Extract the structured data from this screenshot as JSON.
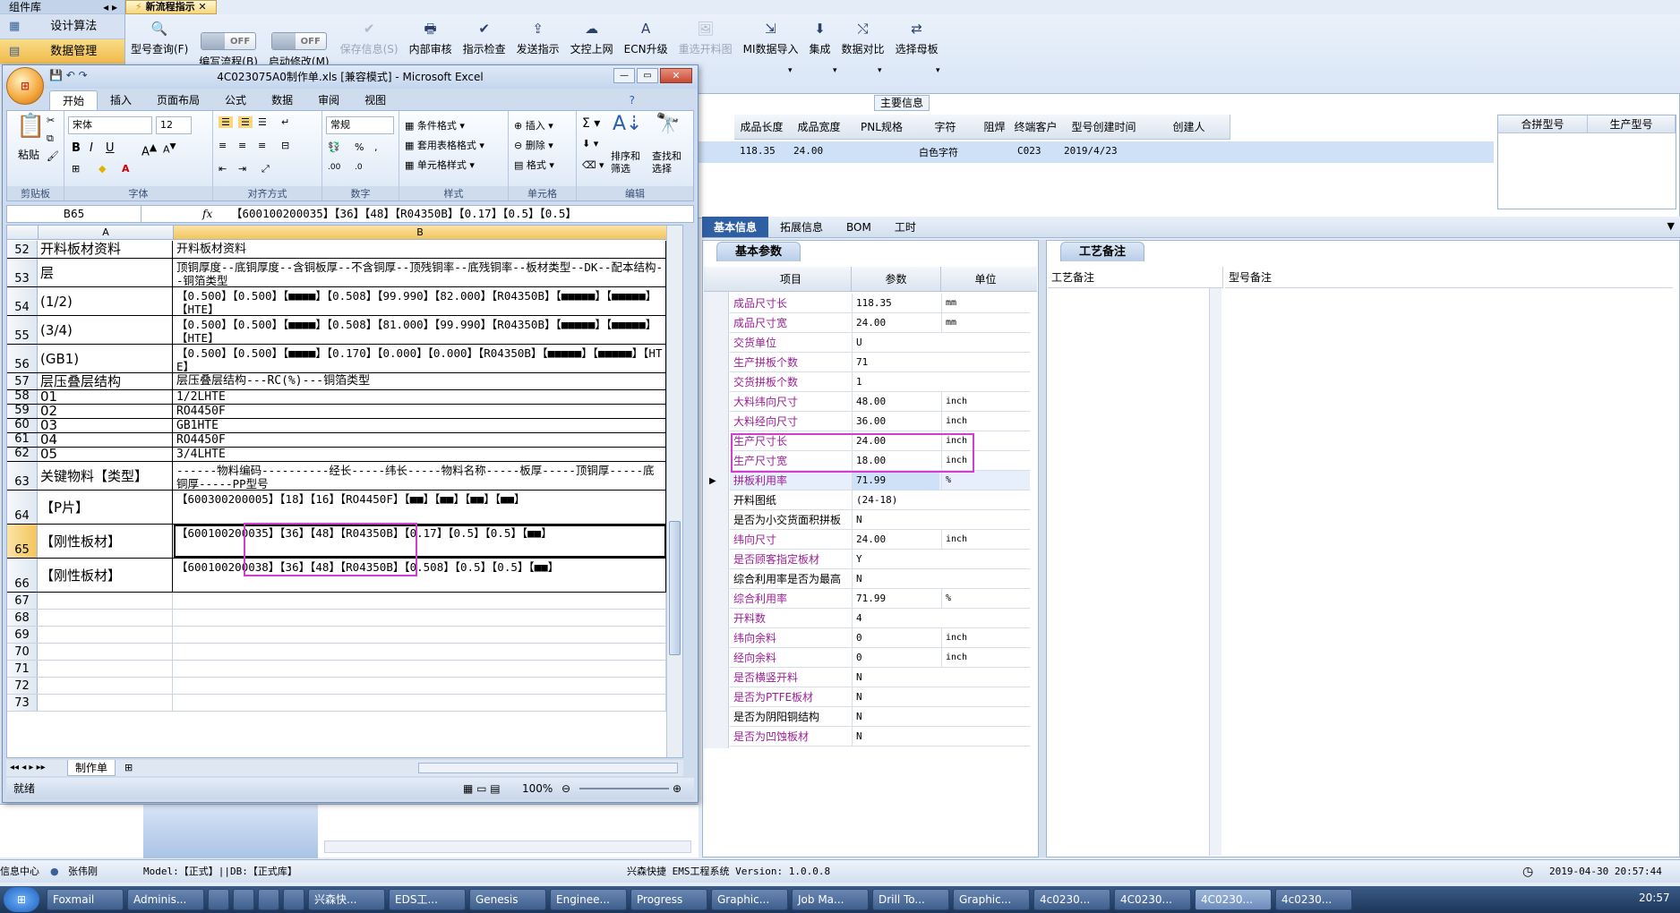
{
  "app": {
    "component_lib": "组件库",
    "doc_tab": "新流程指示",
    "left_nav": [
      "设计算法",
      "数据管理"
    ],
    "toolbar": [
      {
        "label": "型号查询(F)",
        "icon": "search-icon",
        "enabled": true
      },
      {
        "label": "编写流程(B)",
        "icon": "toggle",
        "toggle": "OFF",
        "enabled": true
      },
      {
        "label": "启动修改(M)",
        "icon": "toggle",
        "toggle": "OFF",
        "enabled": true
      },
      {
        "label": "保存信息(S)",
        "icon": "check-icon",
        "enabled": false
      },
      {
        "label": "内部审核",
        "icon": "print-icon",
        "enabled": true
      },
      {
        "label": "指示检查",
        "icon": "check-icon",
        "enabled": true
      },
      {
        "label": "发送指示",
        "icon": "upload-icon",
        "enabled": true
      },
      {
        "label": "文控上网",
        "icon": "cloud-icon",
        "enabled": true
      },
      {
        "label": "ECN升级",
        "icon": "a-icon",
        "enabled": true
      },
      {
        "label": "重选开料图",
        "icon": "image-icon",
        "enabled": false
      },
      {
        "label": "MI数据导入",
        "icon": "import-icon",
        "enabled": true
      },
      {
        "label": "集成",
        "icon": "download-icon",
        "enabled": true
      },
      {
        "label": "数据对比",
        "icon": "compare-icon",
        "enabled": true
      },
      {
        "label": "选择母板",
        "icon": "shuffle-icon",
        "enabled": true
      }
    ],
    "main_info_label": "主要信息",
    "grid_headers": [
      "成品长度",
      "成品宽度",
      "PNL规格",
      "字符",
      "阻焊",
      "终端客户代码",
      "型号创建时间",
      "创建人"
    ],
    "grid_row": [
      "118.35",
      "24.00",
      "",
      "白色字符",
      "",
      "C023",
      "2019/4/23",
      ""
    ],
    "right_headers": [
      "合拼型号",
      "生产型号"
    ],
    "info_tabs": [
      "基本信息",
      "拓展信息",
      "BOM",
      "工时"
    ],
    "basic_params_tab": "基本参数",
    "process_note_tab": "工艺备注",
    "param_headers": [
      "项目",
      "参数",
      "单位"
    ],
    "note_headers": [
      "工艺备注",
      "型号备注"
    ],
    "params": [
      {
        "item": "成品尺寸长",
        "value": "118.35",
        "unit": "mm",
        "purple": true
      },
      {
        "item": "成品尺寸宽",
        "value": "24.00",
        "unit": "mm",
        "purple": true
      },
      {
        "item": "交货单位",
        "value": "U",
        "unit": "",
        "purple": true
      },
      {
        "item": "生产拼板个数",
        "value": "71",
        "unit": "",
        "purple": true
      },
      {
        "item": "交货拼板个数",
        "value": "1",
        "unit": "",
        "purple": true
      },
      {
        "item": "大料纬向尺寸",
        "value": "48.00",
        "unit": "inch",
        "purple": true
      },
      {
        "item": "大料经向尺寸",
        "value": "36.00",
        "unit": "inch",
        "purple": true
      },
      {
        "item": "生产尺寸长",
        "value": "24.00",
        "unit": "inch",
        "purple": true
      },
      {
        "item": "生产尺寸宽",
        "value": "18.00",
        "unit": "inch",
        "purple": true
      },
      {
        "item": "拼板利用率",
        "value": "71.99",
        "unit": "%",
        "purple": true,
        "selected": true
      },
      {
        "item": "开料图纸",
        "value": "(24-18)",
        "unit": "",
        "purple": false
      },
      {
        "item": "是否为小交货面积拼板",
        "value": "N",
        "unit": "",
        "purple": false
      },
      {
        "item": "纬向尺寸",
        "value": "24.00",
        "unit": "inch",
        "purple": true
      },
      {
        "item": "是否顾客指定板材",
        "value": "Y",
        "unit": "",
        "purple": true
      },
      {
        "item": "综合利用率是否为最高",
        "value": "N",
        "unit": "",
        "purple": false
      },
      {
        "item": "综合利用率",
        "value": "71.99",
        "unit": "%",
        "purple": true
      },
      {
        "item": "开料数",
        "value": "4",
        "unit": "",
        "purple": true
      },
      {
        "item": "纬向余料",
        "value": "0",
        "unit": "inch",
        "purple": true
      },
      {
        "item": "经向余料",
        "value": "0",
        "unit": "inch",
        "purple": true
      },
      {
        "item": "是否横竖开料",
        "value": "N",
        "unit": "",
        "purple": true
      },
      {
        "item": "是否为PTFE板材",
        "value": "N",
        "unit": "",
        "purple": true
      },
      {
        "item": "是否为阴阳铜结构",
        "value": "N",
        "unit": "",
        "purple": false
      },
      {
        "item": "是否为凹蚀板材",
        "value": "N",
        "unit": "",
        "purple": true
      }
    ],
    "status": {
      "left": "信息中心",
      "user": "张伟刚",
      "model": "Model:【正式】||DB:【正式库】",
      "center": "兴森快捷 EMS工程系统 Version: 1.0.0.8",
      "datetime": "2019-04-30 20:57:44"
    }
  },
  "excel": {
    "title": "4C023075A0制作单.xls [兼容模式] - Microsoft Excel",
    "tabs": [
      "开始",
      "插入",
      "页面布局",
      "公式",
      "数据",
      "审阅",
      "视图"
    ],
    "groups": [
      "剪贴板",
      "字体",
      "对齐方式",
      "数字",
      "样式",
      "单元格",
      "编辑"
    ],
    "paste": "粘贴",
    "font_name": "宋体",
    "font_size": "12",
    "number_format": "常规",
    "style_buttons": [
      "条件格式",
      "套用表格格式",
      "单元格样式"
    ],
    "cell_buttons": [
      "插入",
      "删除",
      "格式"
    ],
    "edit_buttons": [
      "排序和筛选",
      "查找和选择"
    ],
    "name_box": "B65",
    "fx": "fx",
    "formula": "【600100200035】【36】【48】【R04350B】【0.17】【0.5】【0.5】",
    "col_a": "A",
    "col_b": "B",
    "rows": [
      {
        "n": "52",
        "a": "开料板材资料",
        "b": "开料板材资料",
        "h": 20
      },
      {
        "n": "53",
        "a": "层",
        "b": "顶铜厚度--底铜厚度--含铜板厚--不含铜厚--顶残铜率--底残铜率--板材类型--DK--配本结构--铜箔类型",
        "h": 32
      },
      {
        "n": "54",
        "a": "(1/2)",
        "b": "【0.500】【0.500】【■■■■】【0.508】【99.990】【82.000】【R04350B】【■■■■■】【■■■■■】【HTE】",
        "h": 32
      },
      {
        "n": "55",
        "a": "(3/4)",
        "b": "【0.500】【0.500】【■■■■】【0.508】【81.000】【99.990】【R04350B】【■■■■■】【■■■■■】【HTE】",
        "h": 32
      },
      {
        "n": "56",
        "a": "(GB1)",
        "b": "【0.500】【0.500】【■■■■】【0.170】【0.000】【0.000】【R04350B】【■■■■■】【■■■■■】【HTE】",
        "h": 32
      },
      {
        "n": "57",
        "a": "层压叠层结构",
        "b": "层压叠层结构---RC(%)---铜箔类型",
        "h": 19
      },
      {
        "n": "58",
        "a": "01",
        "b": "1/2LHTE",
        "h": 16
      },
      {
        "n": "59",
        "a": "02",
        "b": "RO4450F",
        "h": 16
      },
      {
        "n": "60",
        "a": "03",
        "b": "GB1HTE",
        "h": 16
      },
      {
        "n": "61",
        "a": "04",
        "b": "RO4450F",
        "h": 16
      },
      {
        "n": "62",
        "a": "05",
        "b": "3/4LHTE",
        "h": 16
      },
      {
        "n": "63",
        "a": "关键物料【类型】",
        "b": "------物料编码----------经长-----纬长-----物料名称-----板厚-----顶铜厚-----底铜厚-----PP型号",
        "h": 32
      },
      {
        "n": "64",
        "a": "【P片】",
        "b": "【600300200005】【18】【16】【RO4450F】【■■】【■■】【■■】【■■】",
        "h": 38
      },
      {
        "n": "65",
        "a": "【刚性板材】",
        "b": "【600100200035】【36】【48】【R04350B】【0.17】【0.5】【0.5】【■■】",
        "h": 38,
        "active": true
      },
      {
        "n": "66",
        "a": "【刚性板材】",
        "b": "【600100200038】【36】【48】【R04350B】【0.508】【0.5】【0.5】【■■】",
        "h": 38
      },
      {
        "n": "67",
        "a": "",
        "b": "",
        "h": 19
      },
      {
        "n": "68",
        "a": "",
        "b": "",
        "h": 19
      },
      {
        "n": "69",
        "a": "",
        "b": "",
        "h": 19
      },
      {
        "n": "70",
        "a": "",
        "b": "",
        "h": 19
      },
      {
        "n": "71",
        "a": "",
        "b": "",
        "h": 19
      },
      {
        "n": "72",
        "a": "",
        "b": "",
        "h": 19
      },
      {
        "n": "73",
        "a": "",
        "b": "",
        "h": 19
      }
    ],
    "sheet_tab": "制作单",
    "status": "就绪",
    "zoom": "100%"
  },
  "taskbar": [
    "Foxmail",
    "Adminis...",
    "",
    "",
    "",
    "",
    "兴森快...",
    "EDS工...",
    "Genesis",
    "Enginee...",
    "Progress",
    "Graphic...",
    "Job Ma...",
    "Drill To...",
    "Graphic...",
    "4c0230...",
    "4C0230...",
    "4C0230...",
    "4c0230..."
  ],
  "clock": "20:57"
}
